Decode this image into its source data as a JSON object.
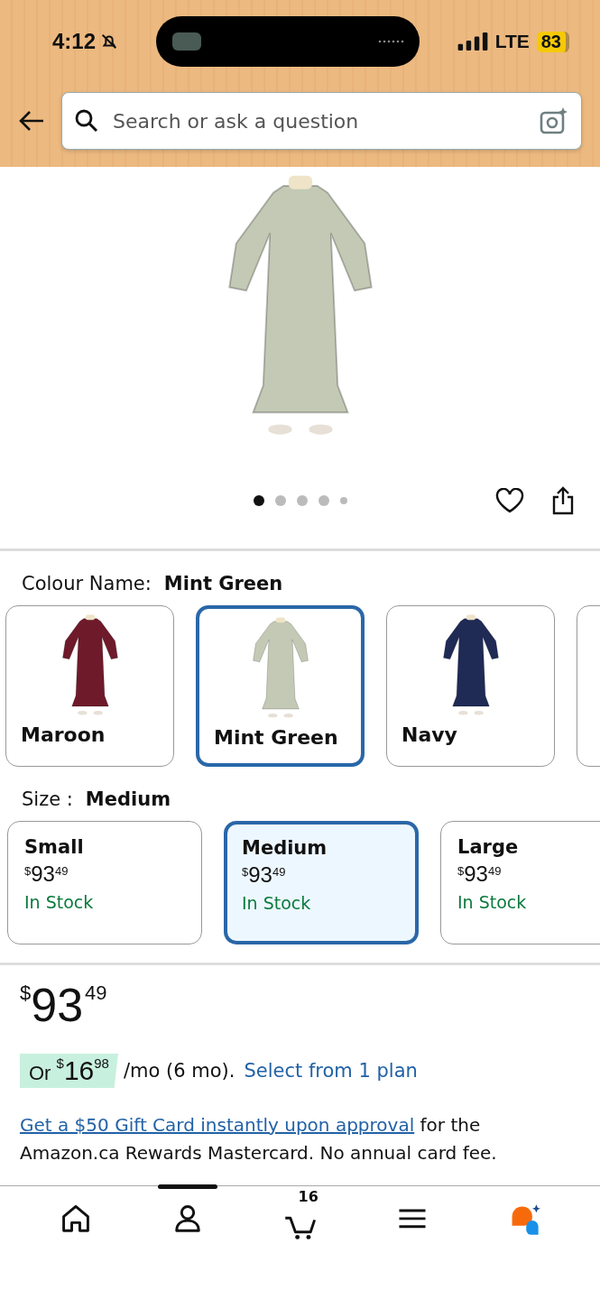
{
  "status_bar": {
    "time": "4:12",
    "network": "LTE",
    "battery": "83"
  },
  "search": {
    "placeholder": "Search or ask a question"
  },
  "gallery": {
    "color": "#c3c9b4",
    "dots": [
      {
        "selected": true
      },
      {
        "selected": false
      },
      {
        "selected": false
      },
      {
        "selected": false
      },
      {
        "selected": false
      }
    ]
  },
  "colour": {
    "label": "Colour Name:",
    "value": "Mint Green",
    "options": [
      {
        "label": "Maroon",
        "selected": false,
        "color": "#6e1a2a"
      },
      {
        "label": "Mint Green",
        "selected": true,
        "color": "#c3c9b4"
      },
      {
        "label": "Navy",
        "selected": false,
        "color": "#1f2a55"
      },
      {
        "selected": false
      }
    ]
  },
  "size": {
    "label": "Size :",
    "value": "Medium",
    "options": [
      {
        "label": "Small",
        "currency": "$",
        "whole": "93",
        "fraction": "49",
        "stock": "In Stock",
        "selected": false
      },
      {
        "label": "Medium",
        "currency": "$",
        "whole": "93",
        "fraction": "49",
        "stock": "In Stock",
        "selected": true
      },
      {
        "label": "Large",
        "currency": "$",
        "whole": "93",
        "fraction": "49",
        "stock": "In Stock",
        "selected": false
      }
    ]
  },
  "price": {
    "currency": "$",
    "whole": "93",
    "fraction": "49"
  },
  "installment": {
    "prefix": "Or",
    "currency": "$",
    "whole": "16",
    "fraction": "98",
    "suffix": "/mo (6 mo).",
    "link": "Select from 1 plan"
  },
  "promo": {
    "link": "Get a $50 Gift Card instantly upon approval",
    "text": "for the Amazon.ca Rewards Mastercard. No annual card fee."
  },
  "nav": [
    {
      "kind": "home",
      "selected": false
    },
    {
      "kind": "account",
      "selected": true
    },
    {
      "kind": "cart",
      "badge": "16",
      "selected": false
    },
    {
      "kind": "menu",
      "selected": false
    },
    {
      "kind": "assistant",
      "selected": false
    }
  ]
}
